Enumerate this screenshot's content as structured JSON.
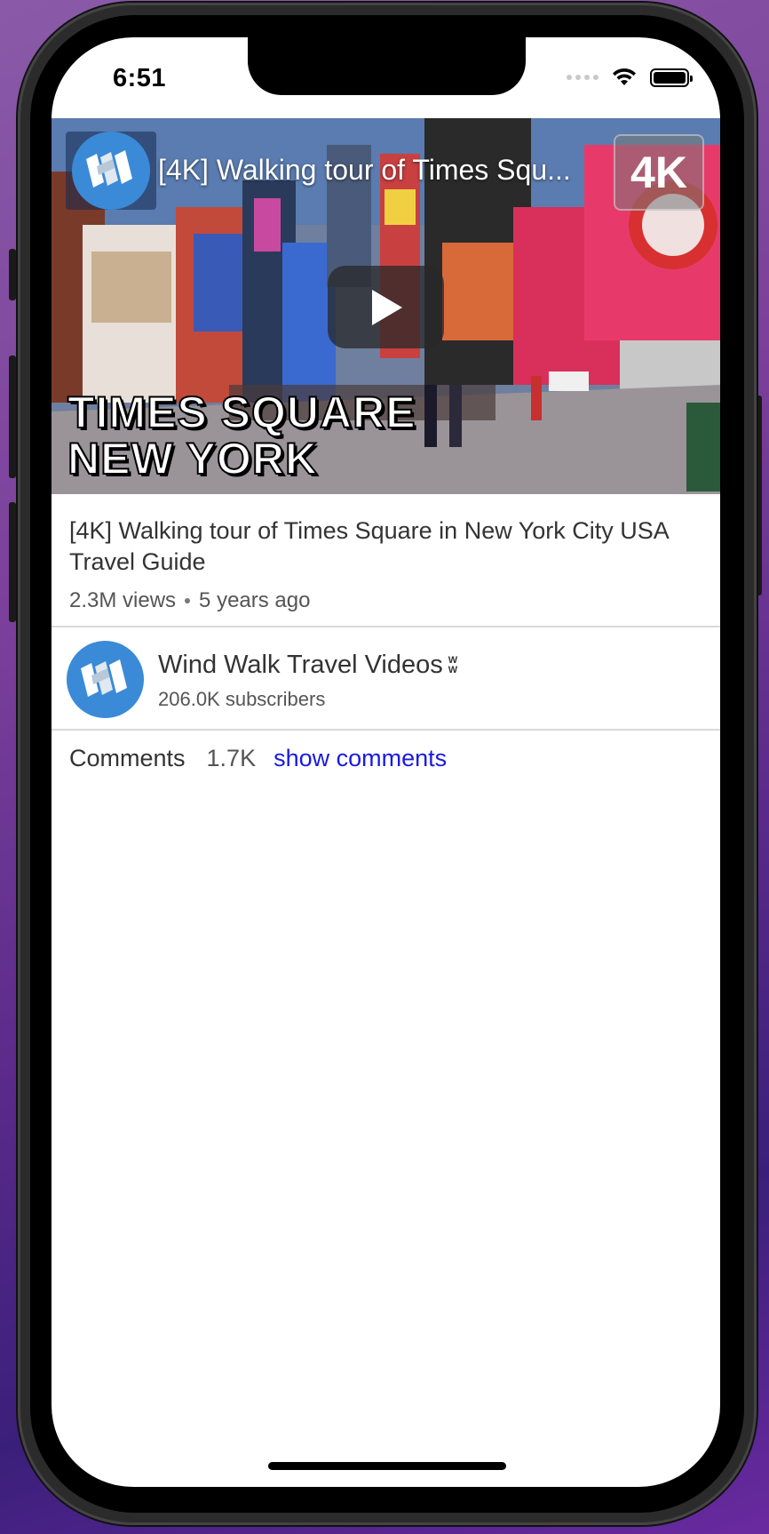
{
  "status_bar": {
    "time": "6:51"
  },
  "video": {
    "overlay_title": "[4K] Walking tour of Times Squ...",
    "quality_badge": "4K",
    "caption_line1": "TIMES SQUARE",
    "caption_line2": "NEW YORK"
  },
  "details": {
    "title": "[4K] Walking tour of Times Square in New York City USA Travel Guide",
    "views": "2.3M views",
    "age": "5 years ago"
  },
  "channel": {
    "name": "Wind Walk Travel Videos",
    "mark_top": "W",
    "mark_bottom": "W",
    "subscribers": "206.0K subscribers",
    "brand_color": "#3b8ad8"
  },
  "comments": {
    "label": "Comments",
    "count": "1.7K",
    "action": "show comments",
    "action_color": "#1a1adf"
  }
}
